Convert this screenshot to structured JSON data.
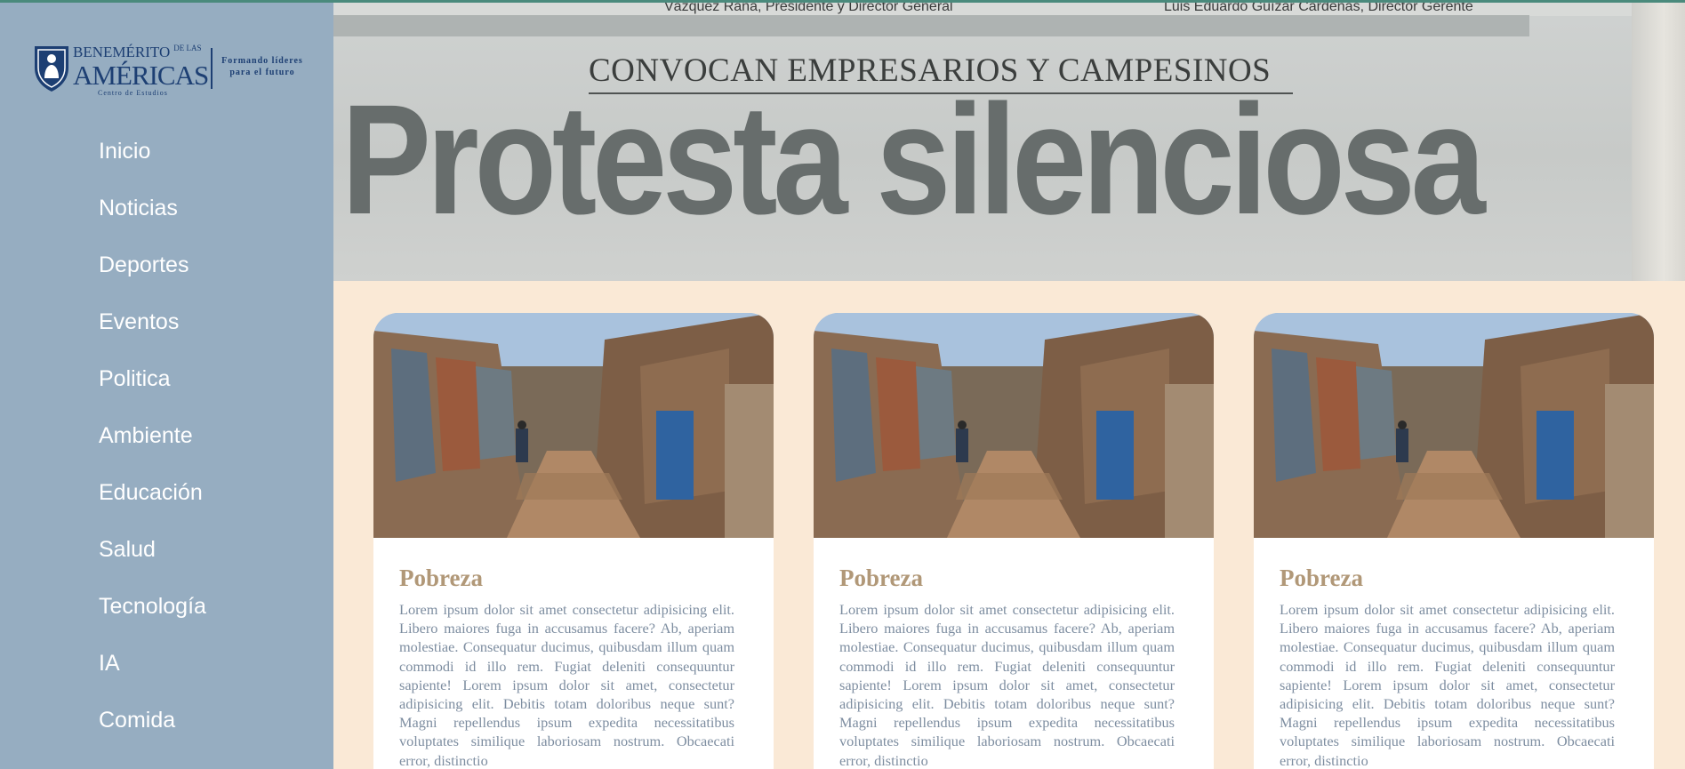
{
  "logo": {
    "line1": "BENEMÉRITO",
    "line1_small": "DE LAS",
    "line2": "AMÉRICAS",
    "line3": "Centro de Estudios",
    "tagline": "Formando líderes para el futuro"
  },
  "nav": {
    "items": [
      {
        "label": "Inicio"
      },
      {
        "label": "Noticias"
      },
      {
        "label": "Deportes"
      },
      {
        "label": "Eventos"
      },
      {
        "label": "Politica"
      },
      {
        "label": "Ambiente"
      },
      {
        "label": "Educación"
      },
      {
        "label": "Salud"
      },
      {
        "label": "Tecnología"
      },
      {
        "label": "IA"
      },
      {
        "label": "Comida"
      }
    ]
  },
  "hero": {
    "credit_left": "Vázquez Raña, Presidente y Director General",
    "credit_right": "Luis Eduardo Guízar Cardenas, Director Gerente",
    "subhead": "CONVOCAN EMPRESARIOS Y CAMPESINOS",
    "headline": "Protesta silenciosa"
  },
  "cards": [
    {
      "title": "Pobreza",
      "text": "Lorem ipsum dolor sit amet consectetur adipisicing elit. Libero maiores fuga in accusamus facere? Ab, aperiam molestiae. Consequatur ducimus, quibusdam illum quam commodi id illo rem. Fugiat deleniti consequuntur sapiente! Lorem ipsum dolor sit amet, consectetur adipisicing elit. Debitis totam doloribus neque sunt? Magni repellendus ipsum expedita necessitatibus voluptates similique laboriosam nostrum. Obcaecati error, distinctio"
    },
    {
      "title": "Pobreza",
      "text": "Lorem ipsum dolor sit amet consectetur adipisicing elit. Libero maiores fuga in accusamus facere? Ab, aperiam molestiae. Consequatur ducimus, quibusdam illum quam commodi id illo rem. Fugiat deleniti consequuntur sapiente! Lorem ipsum dolor sit amet, consectetur adipisicing elit. Debitis totam doloribus neque sunt? Magni repellendus ipsum expedita necessitatibus voluptates similique laboriosam nostrum. Obcaecati error, distinctio"
    },
    {
      "title": "Pobreza",
      "text": "Lorem ipsum dolor sit amet consectetur adipisicing elit. Libero maiores fuga in accusamus facere? Ab, aperiam molestiae. Consequatur ducimus, quibusdam illum quam commodi id illo rem. Fugiat deleniti consequuntur sapiente! Lorem ipsum dolor sit amet, consectetur adipisicing elit. Debitis totam doloribus neque sunt? Magni repellendus ipsum expedita necessitatibus voluptates similique laboriosam nostrum. Obcaecati error, distinctio"
    }
  ],
  "colors": {
    "sidebar_bg": "#96adc1",
    "page_bg": "#fae9d6",
    "card_title": "#b19878",
    "card_text": "#7d8da0",
    "logo_blue": "#1d3f73"
  }
}
